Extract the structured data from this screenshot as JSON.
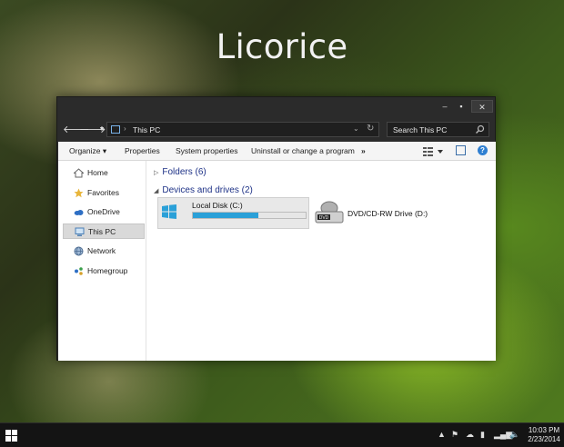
{
  "desktop": {
    "title": "Licorice"
  },
  "window": {
    "controls": {
      "minimize": "–",
      "maximize": "▪",
      "close": "✕"
    },
    "address": {
      "location": "This PC",
      "separator": "›"
    },
    "search": {
      "placeholder": "Search This PC"
    },
    "commands": {
      "organize": "Organize ▾",
      "properties": "Properties",
      "system_properties": "System properties",
      "uninstall": "Uninstall or change a program",
      "more": "»"
    },
    "navigation": [
      {
        "label": "Home",
        "icon": "home-icon"
      },
      {
        "label": "Favorites",
        "icon": "star-icon"
      },
      {
        "label": "OneDrive",
        "icon": "cloud-icon"
      },
      {
        "label": "This PC",
        "icon": "computer-icon",
        "selected": true
      },
      {
        "label": "Network",
        "icon": "network-icon"
      },
      {
        "label": "Homegroup",
        "icon": "homegroup-icon"
      }
    ],
    "groups": {
      "folders": "Folders (6)",
      "devices": "Devices and drives (2)"
    },
    "drives": [
      {
        "name": "Local Disk (C:)",
        "used_fraction": 0.58,
        "bar_color": "#2aa0d8"
      },
      {
        "name": "DVD/CD-RW Drive (D:)",
        "badge": "DVD"
      }
    ]
  },
  "taskbar": {
    "clock_time": "10:03 PM",
    "clock_date": "2/23/2014"
  },
  "colors": {
    "window_dark": "#2b2b2b",
    "accent": "#2aa0d8",
    "group_header": "#1e3287"
  }
}
